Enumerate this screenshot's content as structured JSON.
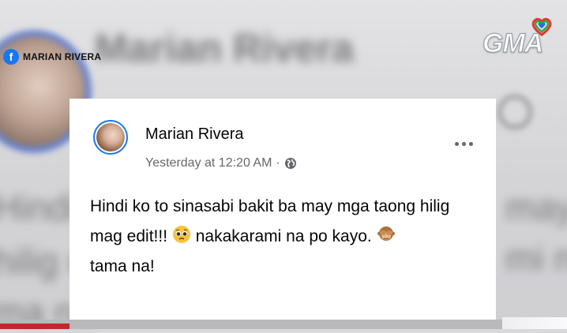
{
  "source_tag": {
    "label": "MARIAN RIVERA",
    "icon": "facebook-icon"
  },
  "broadcaster_logo": {
    "text": "GMA"
  },
  "background": {
    "name": "Marian Rivera",
    "line1": "Hindi",
    "line2": "hilig m",
    "line3": "ma na",
    "right1": "may",
    "right2": "mi na"
  },
  "post": {
    "author": "Marian Rivera",
    "timestamp": "Yesterday at 12:20 AM",
    "separator": "·",
    "privacy_icon": "globe-icon",
    "more_icon": "more-options-icon",
    "text_part1": "Hindi ko to sinasabi bakit ba may mga taong hilig mag edit!!!",
    "text_part2": "nakakarami na po kayo.",
    "text_part3": "tama na!",
    "emoji1": "pleading-face-emoji",
    "emoji2": "see-no-evil-monkey-emoji"
  },
  "colors": {
    "facebook_blue": "#1877f2",
    "meta_gray": "#65676b",
    "bar_red": "#c2282e"
  }
}
